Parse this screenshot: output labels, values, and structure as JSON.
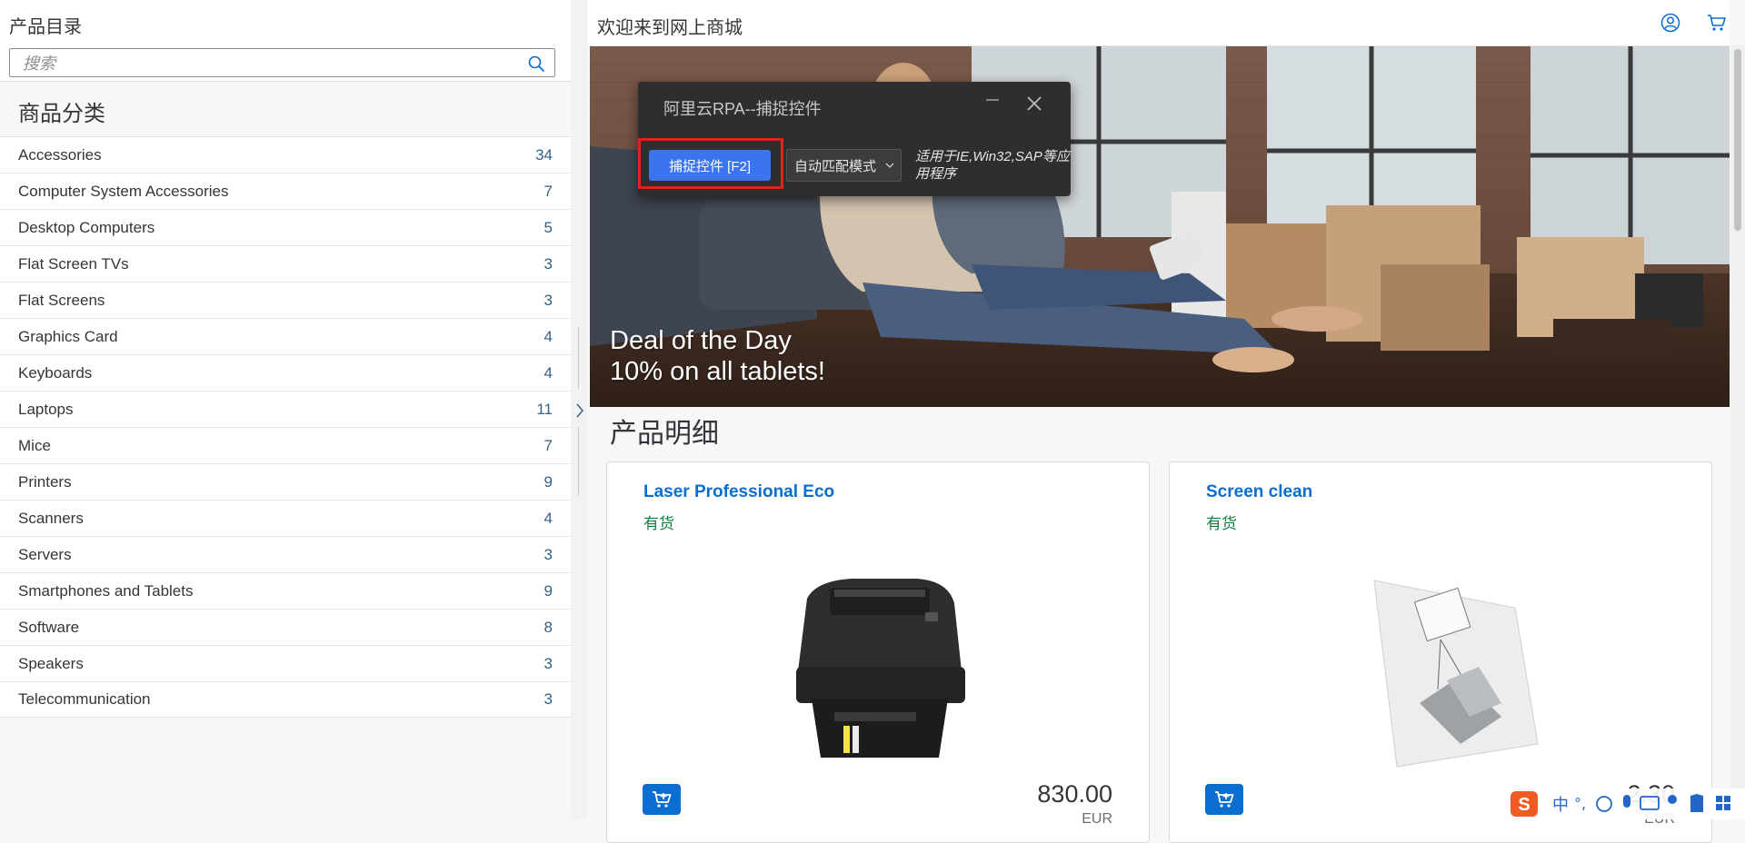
{
  "left_panel": {
    "title": "产品目录",
    "search_placeholder": "搜索",
    "category_heading": "商品分类",
    "categories": [
      {
        "label": "Accessories",
        "count": "34"
      },
      {
        "label": "Computer System Accessories",
        "count": "7"
      },
      {
        "label": "Desktop Computers",
        "count": "5"
      },
      {
        "label": "Flat Screen TVs",
        "count": "3"
      },
      {
        "label": "Flat Screens",
        "count": "3"
      },
      {
        "label": "Graphics Card",
        "count": "4"
      },
      {
        "label": "Keyboards",
        "count": "4"
      },
      {
        "label": "Laptops",
        "count": "11"
      },
      {
        "label": "Mice",
        "count": "7"
      },
      {
        "label": "Printers",
        "count": "9"
      },
      {
        "label": "Scanners",
        "count": "4"
      },
      {
        "label": "Servers",
        "count": "3"
      },
      {
        "label": "Smartphones and Tablets",
        "count": "9"
      },
      {
        "label": "Software",
        "count": "8"
      },
      {
        "label": "Speakers",
        "count": "3"
      },
      {
        "label": "Telecommunication",
        "count": "3"
      }
    ]
  },
  "header": {
    "welcome": "欢迎来到网上商城"
  },
  "hero": {
    "line1": "Deal of the Day",
    "line2": "10% on all tablets!"
  },
  "details": {
    "title": "产品明细",
    "products": [
      {
        "name": "Laser Professional Eco",
        "stock": "有货",
        "price": "830.00",
        "currency": "EUR"
      },
      {
        "name": "Screen clean",
        "stock": "有货",
        "price": "2.30",
        "currency": "EUR"
      }
    ]
  },
  "rpa_dialog": {
    "title": "阿里云RPA--捕捉控件",
    "capture_button": "捕捉控件 [F2]",
    "mode": "自动匹配模式",
    "note": "适用于IE,Win32,SAP等应用程序"
  },
  "ime": {
    "mode": "中"
  },
  "colors": {
    "accent": "#0a6ed1",
    "in_stock": "#107e3e",
    "rpa_button": "#3a74ef",
    "highlight": "#e2201c"
  }
}
